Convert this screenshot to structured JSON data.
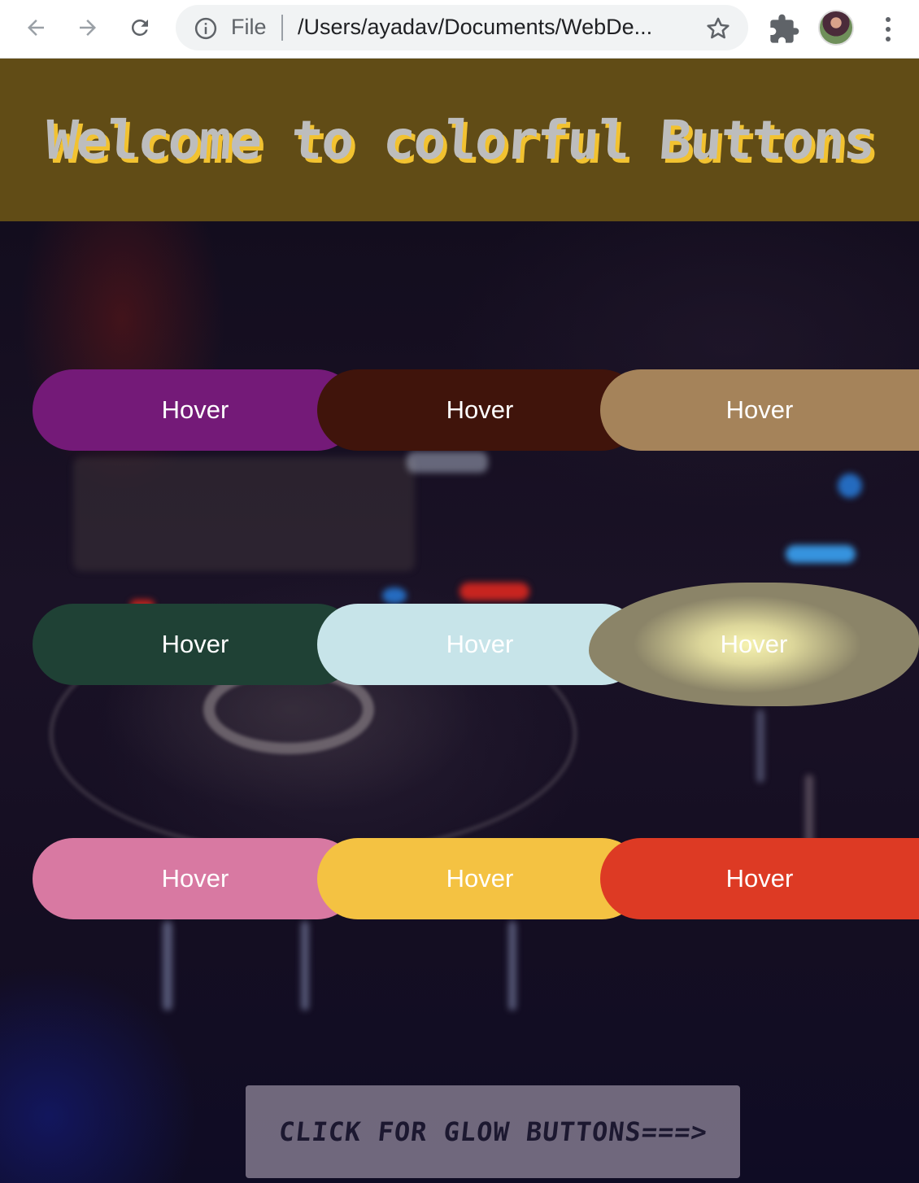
{
  "browser": {
    "scheme_label": "File",
    "url": "/Users/ayadav/Documents/WebDe..."
  },
  "header": {
    "title": "Welcome to colorful Buttons"
  },
  "buttons": [
    {
      "label": "Hover",
      "color": "#741a78"
    },
    {
      "label": "Hover",
      "color": "#40140b"
    },
    {
      "label": "Hover",
      "color": "#a5835a"
    },
    {
      "label": "Hover",
      "color": "#1f4135"
    },
    {
      "label": "Hover",
      "color": "#c7e4e9"
    },
    {
      "label": "Hover",
      "color": "#e9e7a6"
    },
    {
      "label": "Hover",
      "color": "#d879a2"
    },
    {
      "label": "Hover",
      "color": "#f4c242"
    },
    {
      "label": "Hover",
      "color": "#dd3a24"
    }
  ],
  "glow_link": {
    "label": "CLICK FOR GLOW BUTTONS===>"
  },
  "colors": {
    "header_bg": "#614c16",
    "title_fill": "#bdbdbd",
    "title_shadow": "#f2c230"
  }
}
